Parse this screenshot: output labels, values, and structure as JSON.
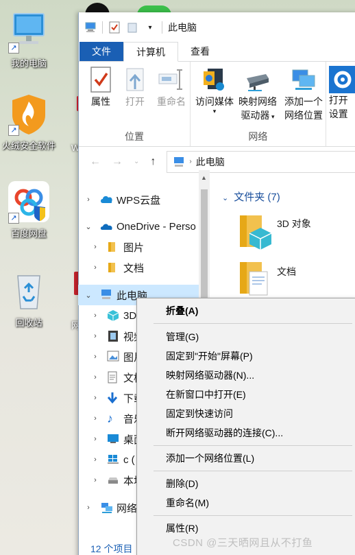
{
  "desktop": {
    "icons": [
      {
        "label": "我的电脑",
        "icon": "computer-icon"
      },
      {
        "label": "火绒安全软件",
        "icon": "huorong-shield-icon"
      },
      {
        "label": "百度网盘",
        "icon": "baidu-netdisk-icon"
      },
      {
        "label": "回收站",
        "icon": "recycle-bin-icon"
      }
    ],
    "partial_labels": [
      "W",
      "网"
    ]
  },
  "window": {
    "title": "此电脑",
    "tabs": [
      "文件",
      "计算机",
      "查看"
    ],
    "active_tab": "计算机",
    "ribbon": {
      "groups": [
        {
          "label": "位置",
          "buttons": [
            "属性",
            "打开",
            "重命名"
          ]
        },
        {
          "label": "网络",
          "buttons": [
            "访问媒体",
            "映射网络\n驱动器",
            "添加一个\n网络位置"
          ]
        },
        {
          "label": "",
          "buttons": [
            "打开\n设置"
          ]
        }
      ],
      "btn_properties": "属性",
      "btn_open": "打开",
      "btn_rename": "重命名",
      "btn_media_line1": "访问媒体",
      "btn_map_line1": "映射网络",
      "btn_map_line2": "驱动器",
      "btn_addloc_line1": "添加一个",
      "btn_addloc_line2": "网络位置",
      "btn_settings_line1": "打开",
      "btn_settings_line2": "设置",
      "group_location": "位置",
      "group_network": "网络"
    },
    "address": {
      "path": "此电脑"
    },
    "nav": [
      {
        "label": "WPS云盘"
      },
      {
        "label": "OneDrive - Perso"
      },
      {
        "label": "图片"
      },
      {
        "label": "文档"
      },
      {
        "label": "此电脑"
      },
      {
        "label": "3D"
      },
      {
        "label": "视频"
      },
      {
        "label": "图片"
      },
      {
        "label": "文档"
      },
      {
        "label": "下载"
      },
      {
        "label": "音乐"
      },
      {
        "label": "桌面"
      },
      {
        "label": "c ("
      },
      {
        "label": "本地"
      },
      {
        "label": "网络"
      }
    ],
    "content": {
      "section": "文件夹 (7)",
      "items": [
        {
          "label": "3D 对象"
        },
        {
          "label": "文档"
        }
      ]
    },
    "status": "12 个项目"
  },
  "context_menu": {
    "items": [
      "折叠(A)",
      "管理(G)",
      "固定到\"开始\"屏幕(P)",
      "映射网络驱动器(N)...",
      "在新窗口中打开(E)",
      "固定到快速访问",
      "断开网络驱动器的连接(C)...",
      "添加一个网络位置(L)",
      "删除(D)",
      "重命名(M)",
      "属性(R)"
    ]
  },
  "watermark": "CSDN @三天晒网且从不打鱼",
  "colors": {
    "accent": "#1a5fb4",
    "selection": "#cce8ff",
    "menu_bg": "#f2f2f2"
  }
}
